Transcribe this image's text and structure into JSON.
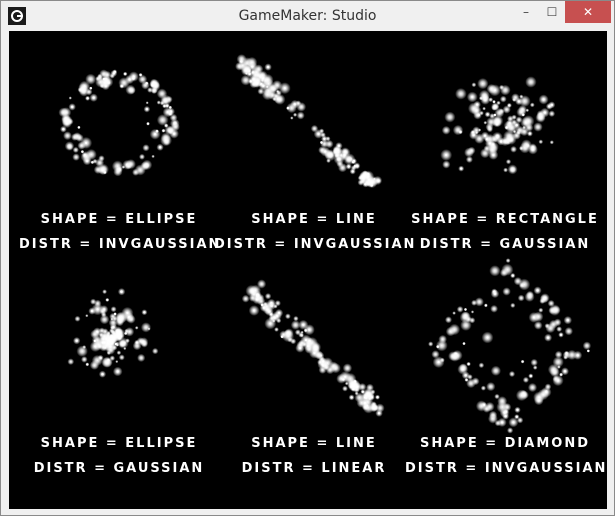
{
  "window": {
    "title": "GameMaker: Studio",
    "controls": {
      "minimize": "–",
      "maximize": "☐",
      "close": "✕"
    }
  },
  "emitters": [
    {
      "shape_line": "SHAPE = ELLIPSE",
      "distr_line": "DISTR = INVGAUSSIAN"
    },
    {
      "shape_line": "SHAPE = LINE",
      "distr_line": "DISTR = INVGAUSSIAN"
    },
    {
      "shape_line": "SHAPE = RECTANGLE",
      "distr_line": "DISTR = GAUSSIAN"
    },
    {
      "shape_line": "SHAPE = ELLIPSE",
      "distr_line": "DISTR = GAUSSIAN"
    },
    {
      "shape_line": "SHAPE = LINE",
      "distr_line": "DISTR = LINEAR"
    },
    {
      "shape_line": "SHAPE = DIAMOND",
      "distr_line": "DISTR = INVGAUSSIAN"
    }
  ]
}
